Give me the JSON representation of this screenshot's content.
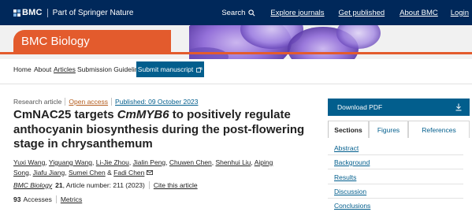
{
  "topbar": {
    "brand": "BMC",
    "brand_part": "Part of Springer Nature",
    "search_label": "Search",
    "nav": [
      "Explore journals",
      "Get published",
      "About BMC",
      "Login"
    ]
  },
  "journal": {
    "name": "BMC Biology",
    "nav": [
      "Home",
      "About",
      "Articles",
      "Submission Guidelines"
    ],
    "submit_label": "Submit manuscript"
  },
  "article": {
    "type": "Research article",
    "access": "Open access",
    "published": "Published: 09 October 2023",
    "title_part1": "CmNAC25 targets ",
    "title_italic": "CmMYB6",
    "title_part2": " to positively regulate anthocyanin biosynthesis during the post-flowering stage in chrysanthemum",
    "authors": [
      "Yuxi Wang",
      "Yiguang Wang",
      "Li-Jie Zhou",
      "Jialin Peng",
      "Chuwen Chen",
      "Shenhui Liu",
      "Aiping Song",
      "Jiafu Jiang",
      "Sumei Chen",
      "Fadi Chen"
    ],
    "journal_name": "BMC Biology",
    "volume": "21",
    "article_number": ", Article number: 211 (2023)",
    "cite_label": "Cite this article",
    "accesses_count": "93",
    "accesses_label": "Accesses",
    "metrics_label": "Metrics"
  },
  "sidebar": {
    "download_label": "Download PDF",
    "tabs": [
      "Sections",
      "Figures",
      "References"
    ],
    "sections": [
      "Abstract",
      "Background",
      "Results",
      "Discussion",
      "Conclusions"
    ]
  },
  "colors": {
    "topbar": "#00285a",
    "accent_orange": "#e35b2d",
    "primary_blue": "#025e8d"
  }
}
